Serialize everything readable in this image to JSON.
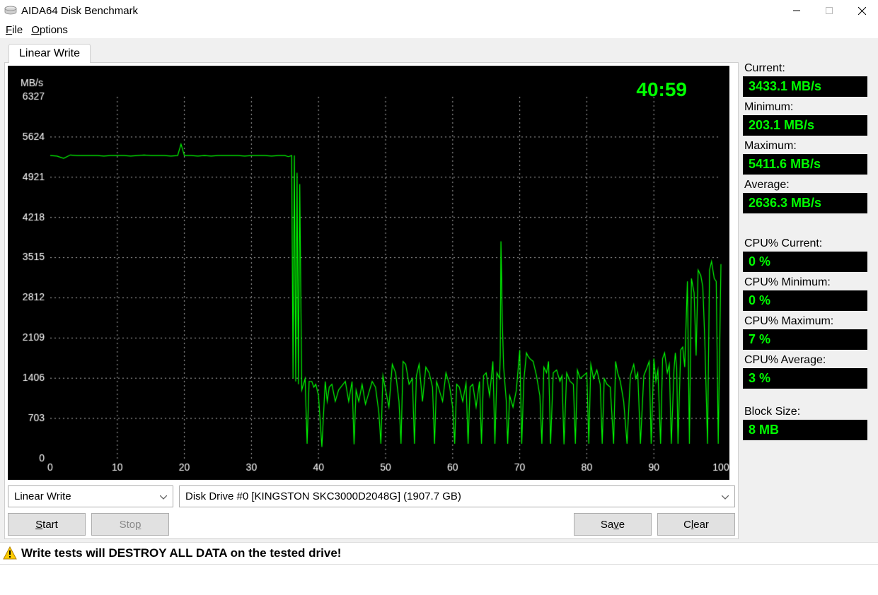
{
  "window": {
    "title": "AIDA64 Disk Benchmark"
  },
  "menu": {
    "file": "File",
    "options": "Options"
  },
  "tab": {
    "label": "Linear Write"
  },
  "chart_timer": "40:59",
  "chart_data": {
    "type": "line",
    "title": "",
    "xlabel": "%",
    "ylabel": "MB/s",
    "xticks": [
      0,
      10,
      20,
      30,
      40,
      50,
      60,
      70,
      80,
      90,
      100
    ],
    "yticks": [
      0,
      703,
      1406,
      2109,
      2812,
      3515,
      4218,
      4921,
      5624,
      6327
    ],
    "xlim": [
      0,
      100
    ],
    "ylim": [
      0,
      6327
    ],
    "x": [
      0,
      1,
      2,
      3,
      4,
      5,
      6,
      7,
      8,
      9,
      10,
      11,
      12,
      13,
      14,
      15,
      16,
      17,
      18,
      19,
      19.5,
      20,
      21,
      22,
      23,
      24,
      25,
      26,
      27,
      28,
      29,
      30,
      31,
      32,
      33,
      34,
      35,
      35.5,
      36,
      36.2,
      36.4,
      36.6,
      36.8,
      37,
      37.2,
      37.5,
      38,
      38.3,
      38.6,
      39,
      39.3,
      39.6,
      40,
      40.5,
      41,
      41.3,
      41.6,
      42,
      42.5,
      43,
      44,
      44.5,
      45,
      45.3,
      45.6,
      46,
      46.5,
      47,
      47.5,
      48,
      48.5,
      49,
      49.3,
      49.6,
      50,
      50.5,
      51,
      51.5,
      52,
      52.3,
      52.6,
      53,
      53.5,
      54,
      54.3,
      54.6,
      55,
      55.5,
      56,
      56.5,
      57,
      57.3,
      57.6,
      58,
      58.5,
      59,
      59.5,
      60,
      60.3,
      60.6,
      61,
      61.5,
      62,
      62.3,
      62.6,
      63,
      63.5,
      64,
      64.3,
      64.6,
      65,
      65.5,
      66,
      66.3,
      66.6,
      67,
      67.1,
      67.2,
      67.4,
      67.6,
      68,
      68.2,
      68.5,
      69,
      69.5,
      70,
      70.3,
      70.6,
      71,
      71.2,
      71.5,
      72,
      72.5,
      73,
      73.3,
      73.6,
      74,
      74.3,
      74.6,
      75,
      75.5,
      76,
      76.3,
      76.6,
      77,
      77.5,
      78,
      78.3,
      78.6,
      79,
      79.5,
      80,
      80.3,
      80.6,
      81,
      81.5,
      82,
      82.3,
      82.6,
      83,
      83.5,
      84,
      84.3,
      84.6,
      85,
      85.5,
      86,
      86.5,
      87,
      87.3,
      87.6,
      88,
      88.5,
      89,
      89.3,
      89.6,
      90,
      90.3,
      90.6,
      91,
      91.3,
      91.6,
      92,
      92.3,
      92.6,
      93,
      93.2,
      93.4,
      93.6,
      94,
      94.3,
      94.6,
      95,
      95.3,
      95.6,
      96,
      96.3,
      96.6,
      97,
      97.3,
      97.6,
      98,
      98.3,
      98.6,
      99,
      99.3,
      99.6,
      100
    ],
    "values": [
      5300,
      5290,
      5250,
      5310,
      5300,
      5300,
      5300,
      5300,
      5290,
      5300,
      5300,
      5300,
      5290,
      5300,
      5310,
      5300,
      5300,
      5300,
      5290,
      5300,
      5500,
      5300,
      5300,
      5290,
      5300,
      5290,
      5300,
      5300,
      5300,
      5300,
      5290,
      5300,
      5300,
      5300,
      5290,
      5300,
      5300,
      5280,
      5300,
      1400,
      5300,
      1350,
      5000,
      1300,
      4800,
      1200,
      1400,
      260,
      1350,
      1350,
      1250,
      1300,
      1100,
      203,
      1350,
      1000,
      1250,
      1300,
      1000,
      1200,
      1350,
      1000,
      1350,
      250,
      1200,
      1000,
      1300,
      950,
      1150,
      1350,
      1250,
      800,
      260,
      1450,
      1200,
      900,
      1650,
      1500,
      1000,
      260,
      1700,
      1650,
      1300,
      1400,
      260,
      1450,
      1650,
      1000,
      1600,
      1500,
      1250,
      260,
      1350,
      1200,
      1000,
      1500,
      1300,
      900,
      260,
      1300,
      1250,
      1000,
      1320,
      260,
      1250,
      1300,
      900,
      1350,
      260,
      1450,
      1500,
      1100,
      1700,
      260,
      1500,
      1400,
      1800,
      3800,
      2400,
      1600,
      1000,
      260,
      1100,
      900,
      1200,
      1900,
      260,
      1350,
      1850,
      1800,
      1750,
      1700,
      1450,
      1100,
      260,
      1600,
      1500,
      1700,
      260,
      1500,
      1550,
      1350,
      1450,
      250,
      1500,
      1350,
      1300,
      260,
      1550,
      1400,
      1450,
      1500,
      260,
      1650,
      1400,
      1550,
      1300,
      260,
      1400,
      1300,
      1250,
      260,
      1700,
      1500,
      1350,
      1000,
      260,
      1450,
      1650,
      1400,
      1500,
      260,
      1450,
      1600,
      1700,
      260,
      1750,
      1350,
      1550,
      260,
      1750,
      1850,
      1500,
      1650,
      260,
      1550,
      1850,
      1600,
      260,
      1900,
      1950,
      1600,
      3100,
      260,
      3150,
      2900,
      1800,
      3300,
      3200,
      3000,
      2050,
      260,
      3300,
      3450,
      3150,
      3100,
      260,
      3400,
      3400,
      300,
      3433
    ]
  },
  "controls": {
    "mode_selected": "Linear Write",
    "drive_selected": "Disk Drive #0  [KINGSTON SKC3000D2048G]  (1907.7 GB)",
    "start_label": "Start",
    "stop_label": "Stop",
    "save_label": "Save",
    "clear_label": "Clear"
  },
  "stats": {
    "current_label": "Current:",
    "current_value": "3433.1 MB/s",
    "minimum_label": "Minimum:",
    "minimum_value": "203.1 MB/s",
    "maximum_label": "Maximum:",
    "maximum_value": "5411.6 MB/s",
    "average_label": "Average:",
    "average_value": "2636.3 MB/s",
    "cpu_current_label": "CPU% Current:",
    "cpu_current_value": "0 %",
    "cpu_minimum_label": "CPU% Minimum:",
    "cpu_minimum_value": "0 %",
    "cpu_maximum_label": "CPU% Maximum:",
    "cpu_maximum_value": "7 %",
    "cpu_average_label": "CPU% Average:",
    "cpu_average_value": "3 %",
    "block_size_label": "Block Size:",
    "block_size_value": "8 MB"
  },
  "warning": {
    "text": "Write tests will DESTROY ALL DATA on the tested drive!"
  }
}
